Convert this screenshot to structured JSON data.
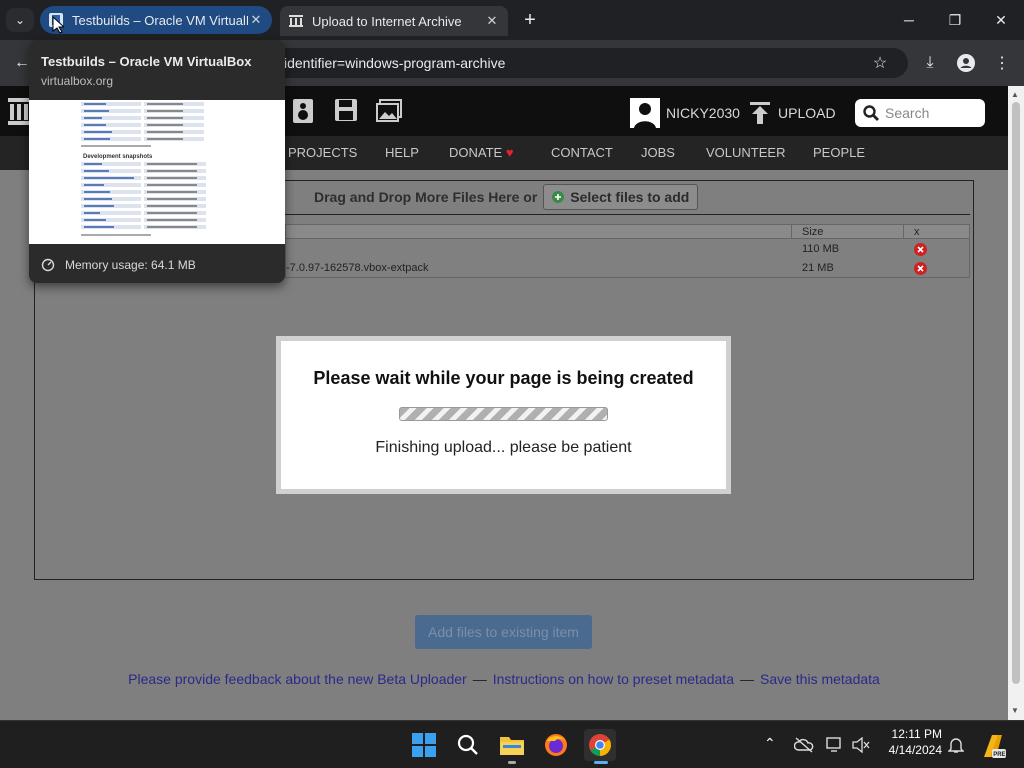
{
  "browser": {
    "tabs": [
      {
        "title": "Testbuilds – Oracle VM VirtualBox",
        "active": true
      },
      {
        "title": "Upload to Internet Archive",
        "active": false
      }
    ],
    "address": "identifier=windows-program-archive"
  },
  "hovercard": {
    "title": "Testbuilds – Oracle VM VirtualBox",
    "url": "virtualbox.org",
    "memory": "Memory usage: 64.1 MB",
    "thumb_heading": "Development snapshots"
  },
  "site": {
    "user": "NICKY2030",
    "upload_label": "UPLOAD",
    "search_placeholder": "Search",
    "nav": [
      "PROJECTS",
      "HELP",
      "DONATE",
      "CONTACT",
      "JOBS",
      "VOLUNTEER",
      "PEOPLE"
    ]
  },
  "uploader": {
    "drop_text": "Drag and Drop More Files Here or",
    "select_label": "Select files to add",
    "table_headers": {
      "size": "Size",
      "x": "x"
    },
    "rows": [
      {
        "name": "",
        "size": "110 MB"
      },
      {
        "name": "-7.0.97-162578.vbox-extpack",
        "size": "21 MB"
      }
    ],
    "modal_title": "Please wait while your page is being created",
    "modal_status": "Finishing upload... please be patient",
    "add_existing": "Add files to existing item",
    "links": {
      "feedback": "Please provide feedback about the new Beta Uploader",
      "instructions": "Instructions on how to preset metadata",
      "save": "Save this metadata",
      "sep": "—"
    }
  },
  "taskbar": {
    "time": "12:11 PM",
    "date": "4/14/2024"
  },
  "colors": {
    "active_tab": "#1f4a82",
    "donate_heart": "#e0242c",
    "remove_icon": "#cc2222"
  }
}
